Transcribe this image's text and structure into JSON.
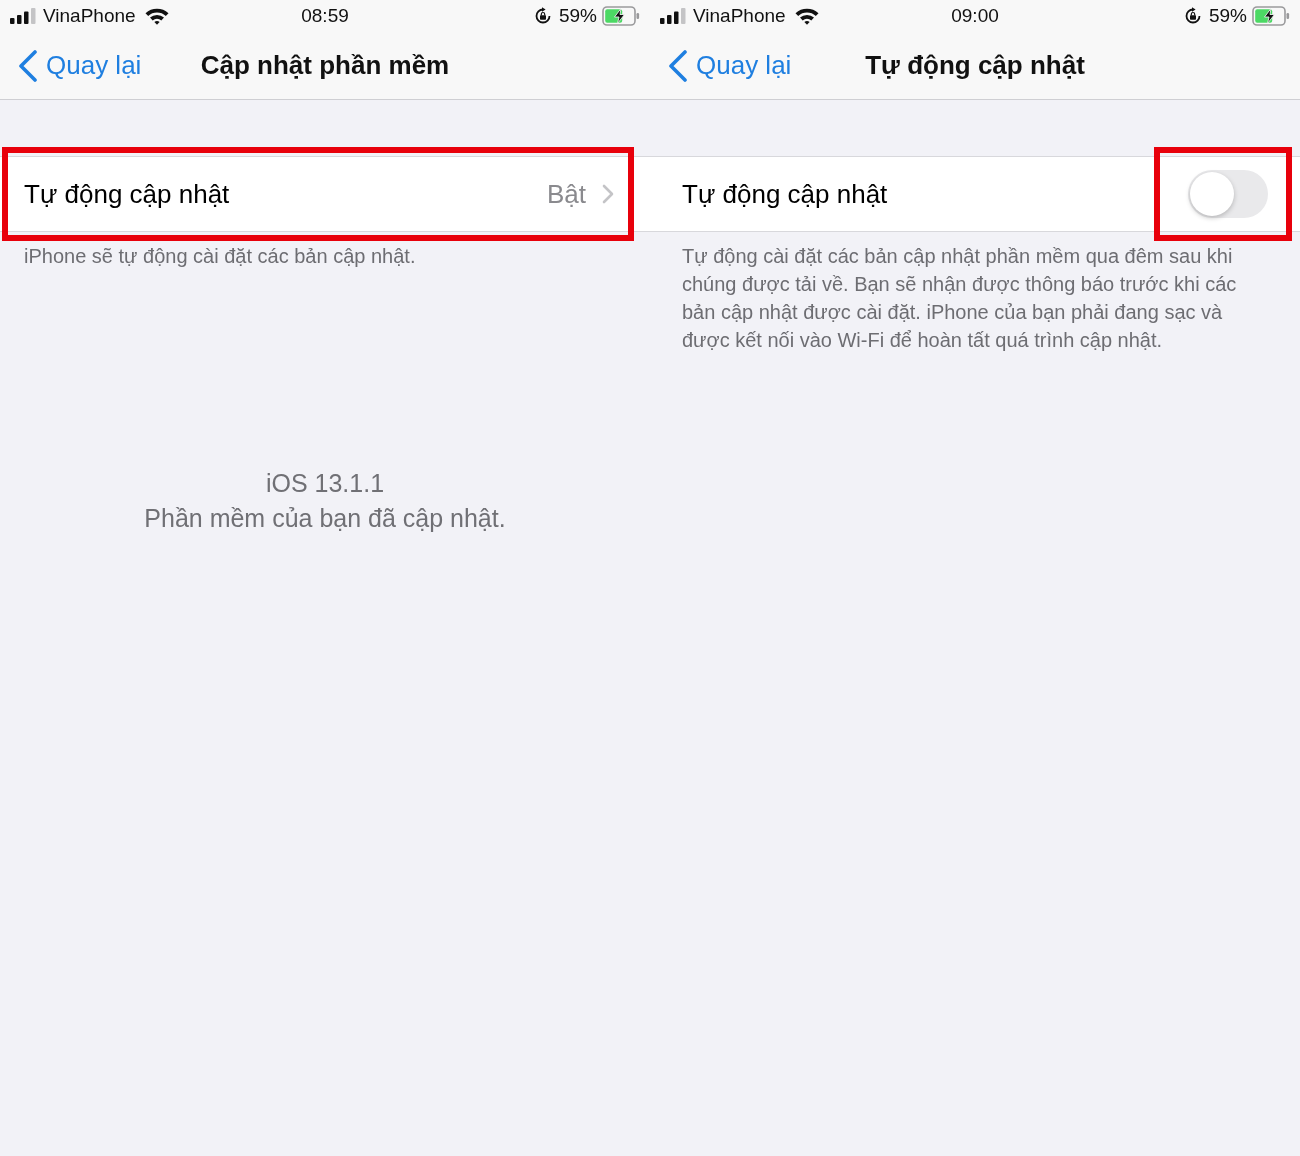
{
  "panels": [
    {
      "status_bar": {
        "carrier": "VinaPhone",
        "time": "08:59",
        "battery": "59%",
        "charging": true
      },
      "nav_bar": {
        "back": "Quay lại",
        "title": "Cập nhật phần mềm"
      },
      "rows": [
        {
          "kind": "disclosure",
          "label": "Tự động cập nhật",
          "value": "Bật",
          "highlighted": true
        }
      ],
      "footer": "iPhone sẽ tự động cài đặt các bản cập nhật.",
      "version": {
        "title": "iOS 13.1.1",
        "message": "Phần mềm của bạn đã cập nhật."
      }
    },
    {
      "status_bar": {
        "carrier": "VinaPhone",
        "time": "09:00",
        "battery": "59%",
        "charging": true
      },
      "nav_bar": {
        "back": "Quay lại",
        "title": "Tự động cập nhật"
      },
      "rows": [
        {
          "kind": "toggle",
          "label": "Tự động cập nhật",
          "on": false,
          "highlighted": true
        }
      ],
      "footer": "Tự động cài đặt các bản cập nhật phần mềm qua đêm sau khi chúng được tải về. Bạn sẽ nhận được thông báo trước khi các bản cập nhật được cài đặt. iPhone của bạn phải đang sạc và được kết nối vào Wi-Fi để hoàn tất quá trình cập nhật."
    }
  ]
}
